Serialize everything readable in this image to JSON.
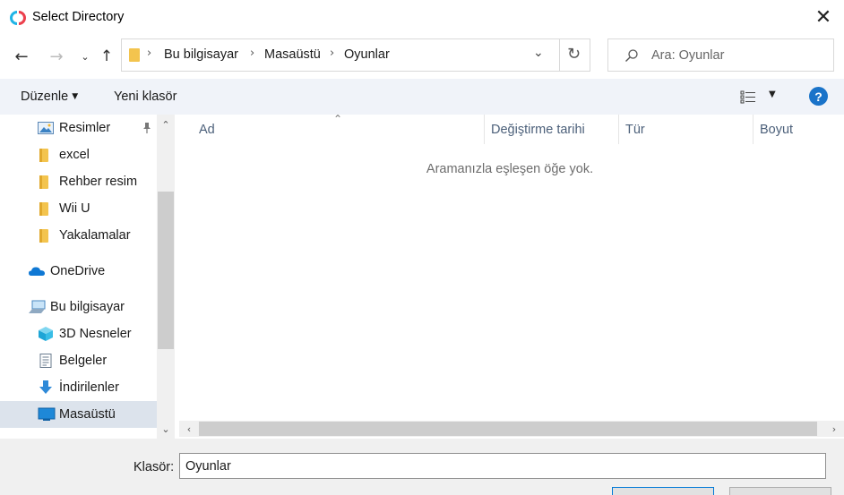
{
  "window": {
    "title": "Select Directory",
    "close_glyph": "✕"
  },
  "nav": {
    "back_glyph": "←",
    "forward_glyph": "→",
    "recent_glyph": "⌄",
    "up_glyph": "↑",
    "breadcrumbs": [
      "Bu bilgisayar",
      "Masaüstü",
      "Oyunlar"
    ],
    "chevron_glyph": "›",
    "dropdown_glyph": "⌄",
    "refresh_glyph": "↻"
  },
  "search": {
    "placeholder": "Ara: Oyunlar"
  },
  "toolbar": {
    "organize_label": "Düzenle",
    "new_folder_label": "Yeni klasör",
    "help_label": "?",
    "caret_glyph": "▼"
  },
  "sidebar": {
    "items": [
      {
        "label": "Resimler",
        "icon": "pictures-icon",
        "pinned": true
      },
      {
        "label": "excel",
        "icon": "folder-icon"
      },
      {
        "label": "Rehber resim",
        "icon": "folder-icon"
      },
      {
        "label": "Wii U",
        "icon": "folder-icon"
      },
      {
        "label": "Yakalamalar",
        "icon": "folder-icon"
      },
      {
        "label": "OneDrive",
        "icon": "onedrive-cloud-icon"
      },
      {
        "label": "Bu bilgisayar",
        "icon": "this-pc-icon"
      },
      {
        "label": "3D Nesneler",
        "icon": "3d-objects-icon"
      },
      {
        "label": "Belgeler",
        "icon": "documents-icon"
      },
      {
        "label": "İndirilenler",
        "icon": "downloads-icon"
      },
      {
        "label": "Masaüstü",
        "icon": "desktop-icon",
        "selected": true
      }
    ],
    "scroll_up_glyph": "⌃",
    "scroll_down_glyph": "⌄"
  },
  "file_list": {
    "columns": [
      "Ad",
      "Değiştirme tarihi",
      "Tür",
      "Boyut"
    ],
    "sort_glyph": "⌃",
    "empty_message": "Aramanızla eşleşen öğe yok.",
    "scroll_left_glyph": "‹",
    "scroll_right_glyph": "›"
  },
  "footer": {
    "folder_label": "Klasör:",
    "folder_value": "Oyunlar"
  },
  "colors": {
    "accent": "#0078d7",
    "help_blue": "#1a73c9",
    "folder_yellow": "#f3c44e",
    "selected_bg": "#dce3ec",
    "command_bar_bg": "#f0f3f9"
  }
}
